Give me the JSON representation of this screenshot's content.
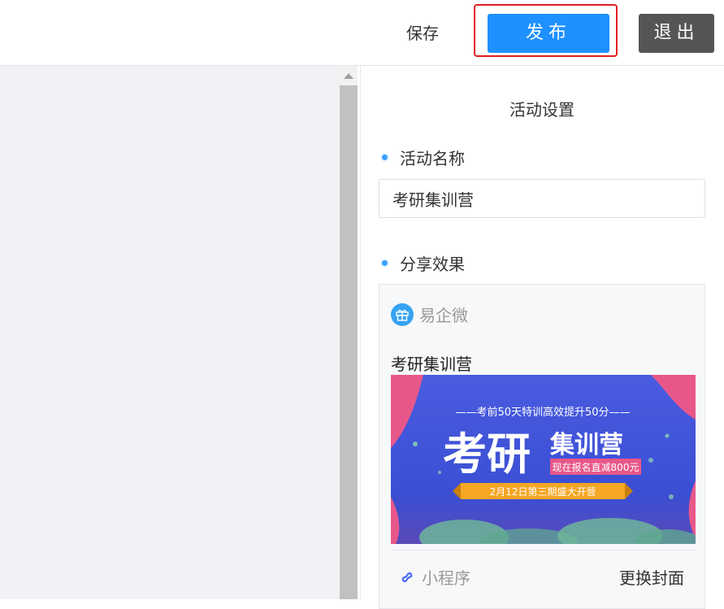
{
  "toolbar": {
    "save_label": "保存",
    "publish_label": "发布",
    "exit_label": "退出"
  },
  "panel": {
    "title": "活动设置",
    "name_section": {
      "label": "活动名称",
      "value": "考研集训营"
    },
    "share_section": {
      "label": "分享效果",
      "brand_name": "易企微",
      "card_title": "考研集训营",
      "banner": {
        "tagline": "——考前50天特训高效提升50分——",
        "big_text": "考研",
        "side_text": "集训营",
        "promo_tag": "现在报名直减800元",
        "ribbon_text": "2月12日第三期盛大开营"
      },
      "mini_program_label": "小程序",
      "change_cover_label": "更换封面"
    }
  },
  "colors": {
    "primary": "#1e90ff",
    "exit": "#555555",
    "highlight_border": "#e02020",
    "banner_bg": "#3a55d6",
    "banner_pink": "#e8578a",
    "ribbon": "#f5a623"
  },
  "icons": {
    "scroll_up": "triangle-up-icon",
    "brand_logo": "gift-icon",
    "mini_program": "mini-program-icon",
    "section_dot": "dot-bullet-icon"
  }
}
